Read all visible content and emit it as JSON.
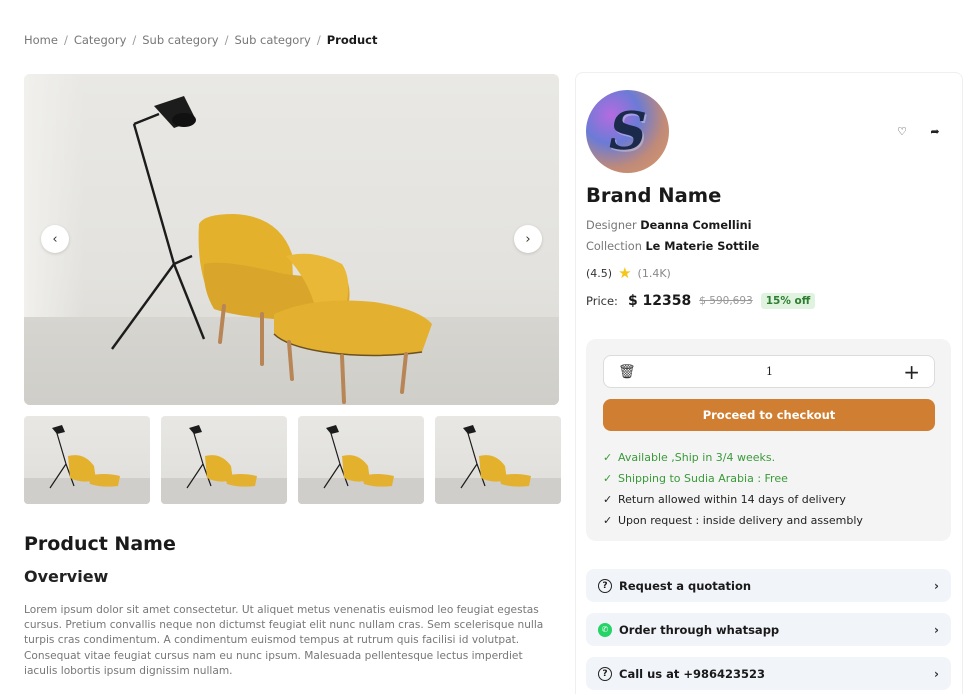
{
  "breadcrumb": {
    "items": [
      "Home",
      "Category",
      "Sub category",
      "Sub category"
    ],
    "current": "Product",
    "separator": "/"
  },
  "gallery": {
    "prev_icon": "chevron-left-icon",
    "next_icon": "chevron-right-icon",
    "thumbnail_count": 4
  },
  "product": {
    "name": "Product Name",
    "overview_heading": "Overview",
    "description": "Lorem ipsum dolor sit amet consectetur. Ut aliquet metus venenatis euismod leo feugiat egestas cursus. Pretium convallis neque non dictumst feugiat elit nunc nullam cras. Sem scelerisque nulla turpis cras condimentum. A condimentum euismod tempus at rutrum quis facilisi id volutpat. Consequat vitae feugiat cursus nam eu nunc ipsum. Malesuada pellentesque lectus imperdiet iaculis lobortis ipsum dignissim nullam."
  },
  "brand": {
    "logo_letter": "S",
    "name": "Brand Name",
    "designer_label": "Designer",
    "designer_value": "Deanna Comellini",
    "collection_label": "Collection",
    "collection_value": "Le Materie Sottile"
  },
  "rating": {
    "score": "(4.5)",
    "count": "(1.4K)",
    "star_color": "#f5c518"
  },
  "price": {
    "label": "Price:",
    "current": "$ 12358",
    "original": "$ 590,693",
    "discount": "15% off"
  },
  "purchase": {
    "quantity": "1",
    "checkout_label": "Proceed to checkout",
    "accent_color": "#d07f32"
  },
  "features": [
    {
      "text": "Available ,Ship in 3/4 weeks.",
      "color": "green"
    },
    {
      "text": "Shipping to Sudia Arabia : Free",
      "color": "green"
    },
    {
      "text": "Return allowed within 14 days of delivery",
      "color": "dark"
    },
    {
      "text": "Upon request : inside delivery and assembly",
      "color": "dark"
    }
  ],
  "actions": {
    "quotation": "Request a quotation",
    "whatsapp": "Order through whatsapp",
    "call": "Call us at +986423523"
  }
}
